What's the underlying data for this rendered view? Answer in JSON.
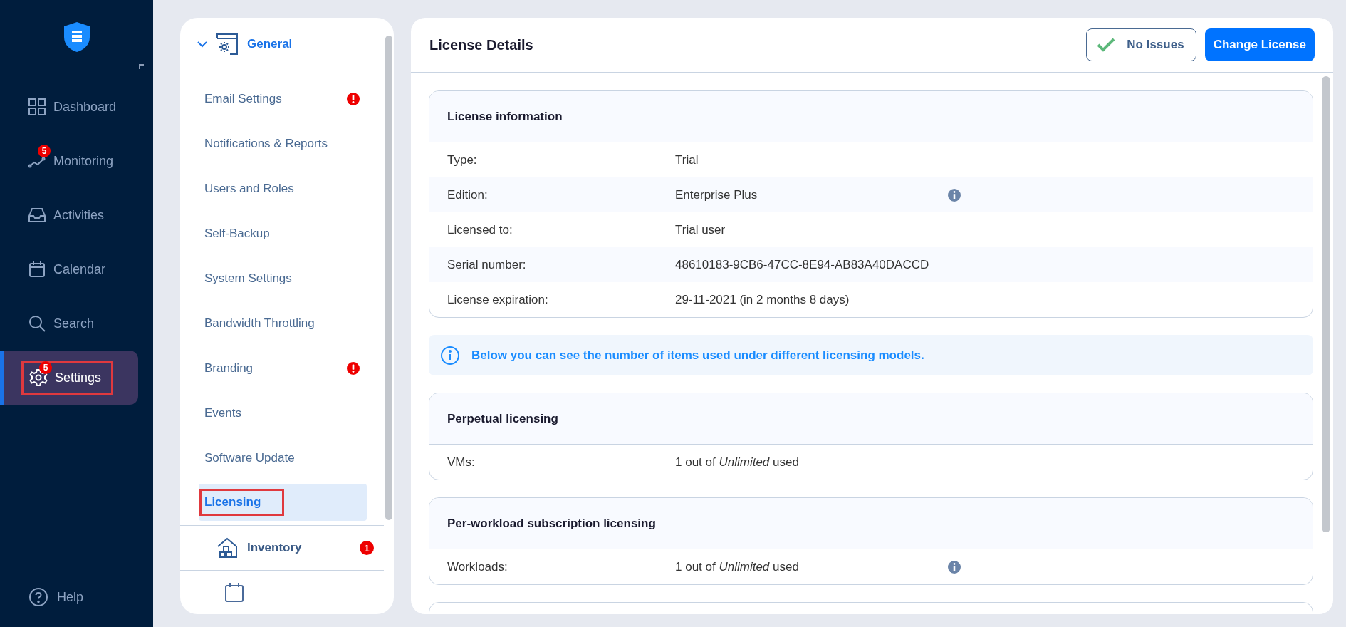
{
  "sidebar": {
    "nav": [
      {
        "label": "Dashboard",
        "selected": false,
        "highlighted": false
      },
      {
        "label": "Monitoring",
        "badge": "5",
        "selected": false,
        "highlighted": false
      },
      {
        "label": "Activities",
        "selected": false,
        "highlighted": false
      },
      {
        "label": "Calendar",
        "selected": false,
        "highlighted": false
      },
      {
        "label": "Search",
        "selected": false,
        "highlighted": false
      },
      {
        "label": "Settings",
        "badge": "5",
        "selected": true,
        "highlighted": true
      }
    ],
    "help": {
      "label": "Help"
    }
  },
  "settings_menu": {
    "sections": [
      {
        "label": "General",
        "expanded": true,
        "items": [
          {
            "label": "Email Settings",
            "alert": true,
            "selected": false,
            "highlighted": false
          },
          {
            "label": "Notifications & Reports",
            "alert": false,
            "selected": false,
            "highlighted": false
          },
          {
            "label": "Users and Roles",
            "alert": false,
            "selected": false,
            "highlighted": false
          },
          {
            "label": "Self-Backup",
            "alert": false,
            "selected": false,
            "highlighted": false
          },
          {
            "label": "System Settings",
            "alert": false,
            "selected": false,
            "highlighted": false
          },
          {
            "label": "Bandwidth Throttling",
            "alert": false,
            "selected": false,
            "highlighted": false
          },
          {
            "label": "Branding",
            "alert": true,
            "selected": false,
            "highlighted": false
          },
          {
            "label": "Events",
            "alert": false,
            "selected": false,
            "highlighted": false
          },
          {
            "label": "Software Update",
            "alert": false,
            "selected": false,
            "highlighted": false
          },
          {
            "label": "Licensing",
            "alert": false,
            "selected": true,
            "highlighted": true
          }
        ]
      },
      {
        "label": "Inventory",
        "expanded": false,
        "badge": "1"
      }
    ]
  },
  "main": {
    "title": "License Details",
    "status_button": {
      "label": "No Issues"
    },
    "action_button": {
      "label": "Change License"
    },
    "sections": [
      {
        "kind": "card",
        "title": "License information",
        "rows": [
          {
            "label": "Type:",
            "value": "Trial",
            "info": false
          },
          {
            "label": "Edition:",
            "value": "Enterprise Plus",
            "info": true
          },
          {
            "label": "Licensed to:",
            "value": "Trial user",
            "info": false
          },
          {
            "label": "Serial number:",
            "value": "48610183-9CB6-47CC-8E94-AB83A40DACCD",
            "info": false
          },
          {
            "label": "License expiration:",
            "value": "29-11-2021 (in 2 months 8 days)",
            "info": false
          }
        ]
      },
      {
        "kind": "banner",
        "text": "Below you can see the number of items used under different licensing models."
      },
      {
        "kind": "card",
        "title": "Perpetual licensing",
        "rows": [
          {
            "label": "VMs:",
            "value": "1 out of *Unlimited* used",
            "info": false
          }
        ]
      },
      {
        "kind": "card",
        "title": "Per-workload subscription licensing",
        "rows": [
          {
            "label": "Workloads:",
            "value": "1 out of *Unlimited* used",
            "info": true
          }
        ]
      }
    ]
  }
}
